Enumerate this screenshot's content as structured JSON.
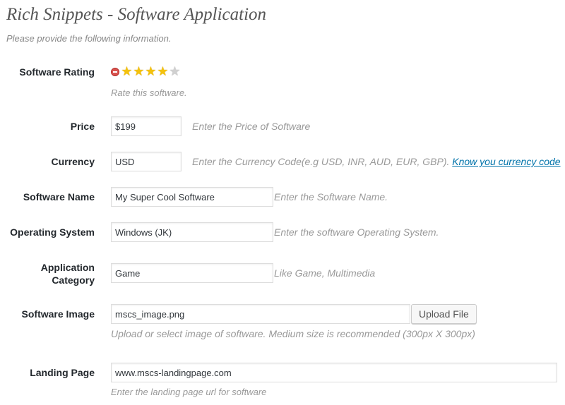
{
  "header": {
    "title": "Rich Snippets - Software Application",
    "intro": "Please provide the following information."
  },
  "rating": {
    "label": "Software Rating",
    "value": 4,
    "max": 5,
    "hint": "Rate this software.",
    "colors": {
      "on": "#f4c20d",
      "off": "#d0d0d0",
      "cancel": "#d9534f"
    }
  },
  "price": {
    "label": "Price",
    "value": "$199",
    "hint": "Enter the Price of Software"
  },
  "currency": {
    "label": "Currency",
    "value": "USD",
    "hint": "Enter the Currency Code(e.g USD, INR, AUD, EUR, GBP).",
    "link_text": "Know you currency code"
  },
  "software_name": {
    "label": "Software Name",
    "value": "My Super Cool Software",
    "hint": "Enter the Software Name."
  },
  "operating_system": {
    "label": "Operating System",
    "value": "Windows (JK)",
    "hint": "Enter the software Operating System."
  },
  "category": {
    "label_line1": "Application",
    "label_line2": "Category",
    "value": "Game",
    "hint": "Like Game, Multimedia"
  },
  "image": {
    "label": "Software Image",
    "value": "mscs_image.png",
    "button_label": "Upload File",
    "hint": "Upload or select image of software. Medium size is recommended (300px X 300px)"
  },
  "landing_page": {
    "label": "Landing Page",
    "value": "www.mscs-landingpage.com",
    "hint": "Enter the landing page url for software"
  },
  "colors": {
    "link": "#0073aa",
    "hint": "#999999",
    "label": "#23282d"
  }
}
